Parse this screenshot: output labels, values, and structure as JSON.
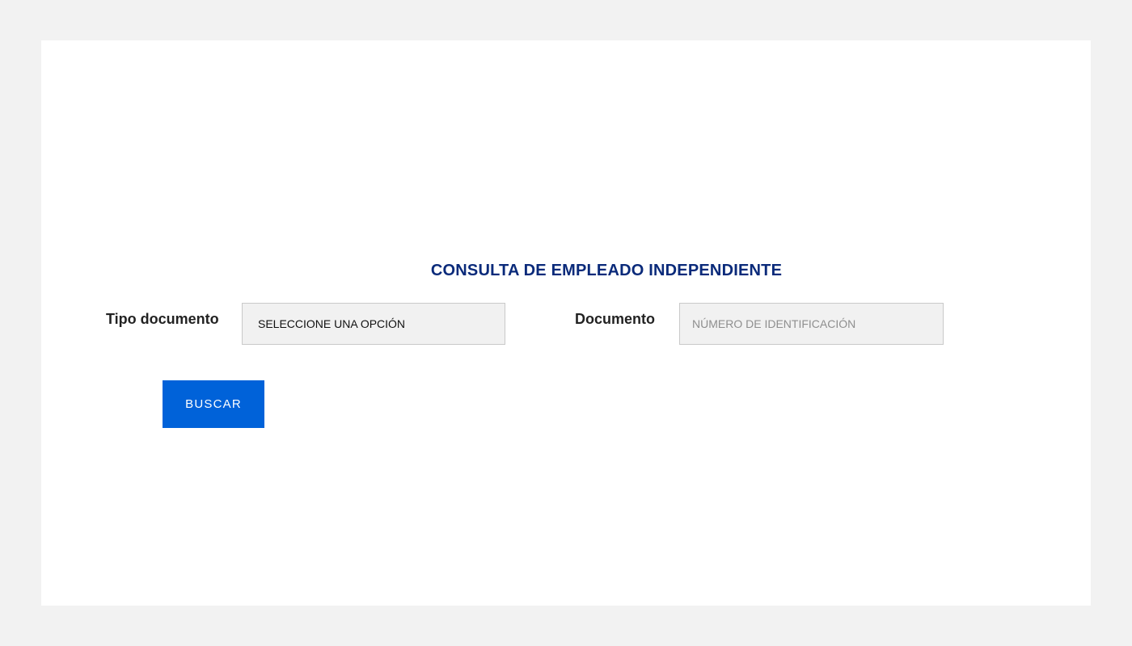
{
  "form": {
    "title": "CONSULTA DE EMPLEADO INDEPENDIENTE",
    "tipo_documento": {
      "label": "Tipo documento",
      "selected_value": "SELECCIONE UNA OPCIÓN"
    },
    "documento": {
      "label": "Documento",
      "value": "",
      "placeholder": "NÚMERO DE IDENTIFICACIÓN"
    },
    "search_button_label": "BUSCAR"
  },
  "colors": {
    "page_background": "#f2f2f2",
    "card_background": "#ffffff",
    "title": "#0a2a7a",
    "button": "#0062d9",
    "field_background": "#f1f1f1",
    "field_border": "#c9c9c9"
  }
}
